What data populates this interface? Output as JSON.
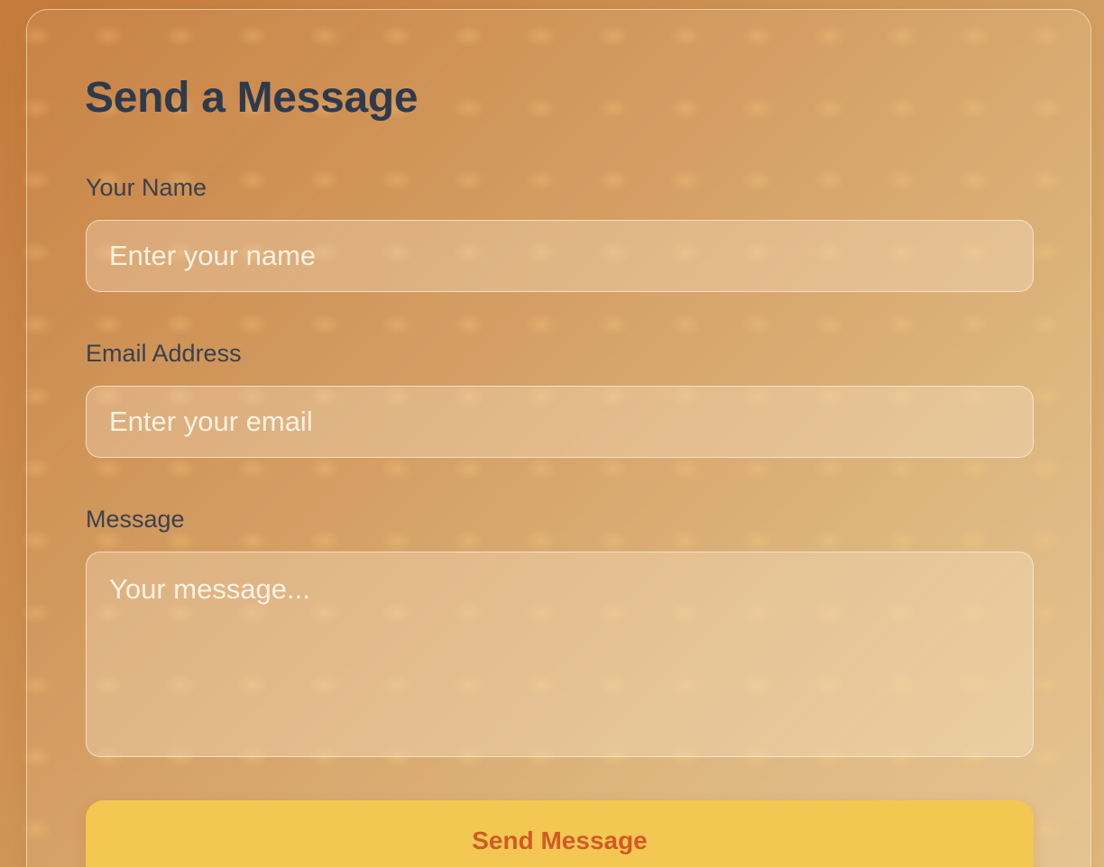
{
  "form": {
    "title": "Send a Message",
    "fields": [
      {
        "label": "Your Name",
        "placeholder": "Enter your name",
        "value": ""
      },
      {
        "label": "Email Address",
        "placeholder": "Enter your email",
        "value": ""
      },
      {
        "label": "Message",
        "placeholder": "Your message...",
        "value": ""
      }
    ],
    "submit_label": "Send Message"
  },
  "colors": {
    "title": "#2e3a4c",
    "label": "#39414f",
    "button_background": "#f2c753",
    "button_text": "#d25a26",
    "background_start": "#c57b3c",
    "background_end": "#e0bb82"
  }
}
